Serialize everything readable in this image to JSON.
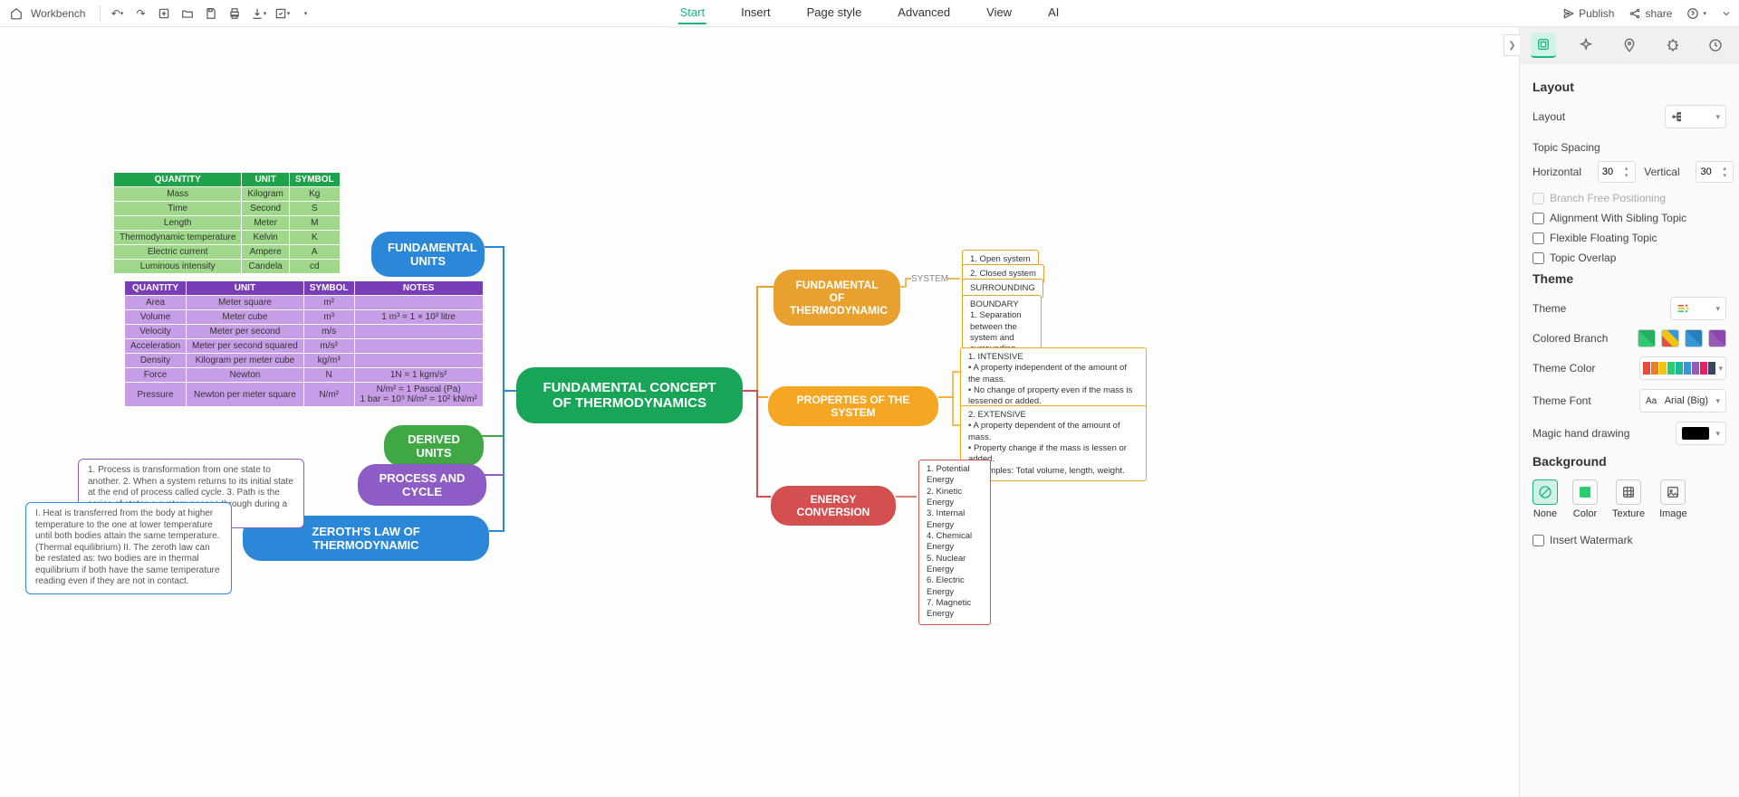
{
  "topbar": {
    "workbench": "Workbench",
    "publish": "Publish",
    "share": "share"
  },
  "menus": [
    "Start",
    "Insert",
    "Page style",
    "Advanced",
    "View",
    "AI"
  ],
  "activeMenu": "Start",
  "sidebar": {
    "layout": {
      "title": "Layout",
      "layoutLabel": "Layout",
      "topicSpacing": "Topic Spacing",
      "horizontal": "Horizontal",
      "hVal": "30",
      "vertical": "Vertical",
      "vVal": "30",
      "branchFree": "Branch Free Positioning",
      "alignSibling": "Alignment With Sibling Topic",
      "flexFloat": "Flexible Floating Topic",
      "overlap": "Topic Overlap"
    },
    "theme": {
      "title": "Theme",
      "themeLabel": "Theme",
      "coloredBranch": "Colored Branch",
      "themeColor": "Theme Color",
      "themeFont": "Theme Font",
      "fontVal": "Arial (Big)",
      "magicHand": "Magic hand drawing"
    },
    "background": {
      "title": "Background",
      "opts": [
        "None",
        "Color",
        "Texture",
        "Image"
      ],
      "watermark": "Insert Watermark"
    }
  },
  "mindmap": {
    "center": "FUNDAMENTAL CONCEPT OF THERMODYNAMICS",
    "left": {
      "fundUnits": "FUNDAMENTAL UNITS",
      "derivedUnits": "DERIVED UNITS",
      "processCycle": "PROCESS AND CYCLE",
      "zeroth": "ZEROTH'S LAW OF THERMODYNAMIC",
      "processNote": "1. Process is transformation from one state to another. 2. When a system returns to its initial state at the end of process called cycle. 3. Path is the series of states a system passes through during a process.",
      "zerothNote": "I. Heat is transferred from the body at higher temperature to the one at lower temperature until both bodies attain the same temperature. (Thermal equilibrium) II. The zeroth law can be restated as: two bodies are in thermal equilibrium if both have the same temperature reading even if they are not in contact."
    },
    "right": {
      "fundThermo": "FUNDAMENTAL OF THERMODYNAMIC",
      "system": "SYSTEM",
      "sys1": "1. Open system",
      "sys2": "2. Closed system",
      "surrounding": "SURROUNDING",
      "boundary": "BOUNDARY\n1. Separation between the system and surrounding.",
      "properties": "PROPERTIES OF THE SYSTEM",
      "intensive": "1. INTENSIVE\n• A property independent of the amount of the mass.\n• No change of property even if the mass is lessened or added.\n• Examples: Colour, temperature, pressure",
      "extensive": "2. EXTENSIVE\n• A property dependent of the amount of mass.\n• Property change if the mass is lessen or added.\n• Examples: Total volume, length, weight.",
      "energyConv": "ENERGY CONVERSION",
      "energyList": "1. Potential Energy\n2. Kinetic Energy\n3. Internal Energy\n4. Chemical Energy\n5. Nuclear Energy\n6. Electric Energy\n7. Magnetic Energy"
    },
    "greenTable": {
      "headers": [
        "QUANTITY",
        "UNIT",
        "SYMBOL"
      ],
      "rows": [
        [
          "Mass",
          "Kilogram",
          "Kg"
        ],
        [
          "Time",
          "Second",
          "S"
        ],
        [
          "Length",
          "Meter",
          "M"
        ],
        [
          "Thermodynamic temperature",
          "Kelvin",
          "K"
        ],
        [
          "Electric current",
          "Ampere",
          "A"
        ],
        [
          "Luminous intensity",
          "Candela",
          "cd"
        ]
      ]
    },
    "purpleTable": {
      "headers": [
        "QUANTITY",
        "UNIT",
        "SYMBOL",
        "NOTES"
      ],
      "rows": [
        [
          "Area",
          "Meter square",
          "m²",
          ""
        ],
        [
          "Volume",
          "Meter cube",
          "m³",
          "1 m³ = 1 × 10³ litre"
        ],
        [
          "Velocity",
          "Meter per second",
          "m/s",
          ""
        ],
        [
          "Acceleration",
          "Meter per second squared",
          "m/s²",
          ""
        ],
        [
          "Density",
          "Kilogram per meter cube",
          "kg/m³",
          ""
        ],
        [
          "Force",
          "Newton",
          "N",
          "1N = 1 kgm/s²"
        ],
        [
          "Pressure",
          "Newton per meter square",
          "N/m²",
          "N/m² = 1 Pascal (Pa)\n1 bar = 10⁵ N/m² = 10² kN/m²"
        ]
      ]
    }
  }
}
